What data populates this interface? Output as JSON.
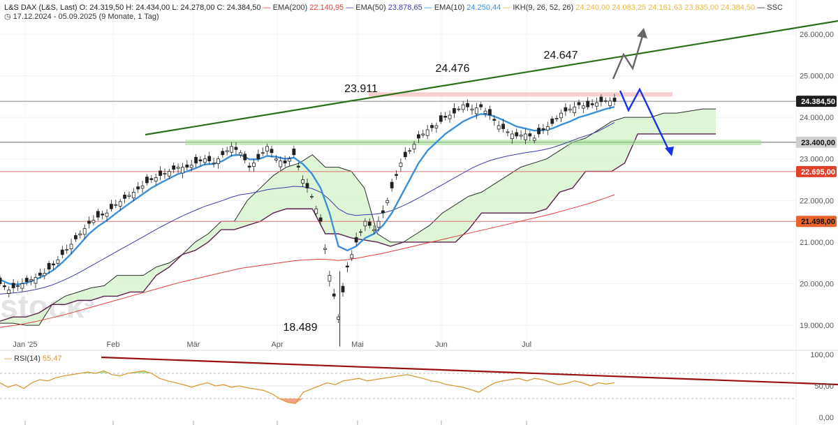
{
  "header": {
    "symbol": "L&S DAX (L&S, Last)",
    "ohlc": "O: 24.319,50   H: 24.434,00   L: 24.278,00   C: 24.384,50",
    "range": "17.12.2024 - 05.09.2025   (9 Monate, 1 Tag)",
    "indicators": [
      {
        "label": "EMA(200)",
        "value": "22.140,95",
        "color": "#e03c3c"
      },
      {
        "label": "EMA(50)",
        "value": "23.878,65",
        "color": "#3c3ca8"
      },
      {
        "label": "EMA(10)",
        "value": "24.250,44",
        "color": "#3a8fd8"
      },
      {
        "label": "IKH(9, 26, 52, 26)",
        "value": "24.240,00   24.083,25   24.161,63   23.835,00   24.384,50",
        "color": "#e6b84a"
      },
      {
        "label": "SSC",
        "value": "",
        "color": "#222222"
      }
    ]
  },
  "watermark": "stock³",
  "colors": {
    "price_up": "#222222",
    "ema10": "#3a8fd8",
    "ema50": "#3c3ca8",
    "ema200": "#e03c3c",
    "cloud_fill": "#d8f5d0",
    "cloud_fill_bear": "#f7d6d6",
    "cloud_line": "#5a1e4e",
    "trend_green": "#2a6e1a",
    "rsi_line": "#d89a3a",
    "rsi_trend": "#9a1010",
    "label_red": "#e0402a",
    "label_orange": "#e8622c",
    "label_black": "#1e1e1e"
  },
  "chart_data": {
    "type": "candlestick",
    "x_ticks": [
      "Jan '25",
      "Feb",
      "Mär",
      "Apr",
      "Mai",
      "Jun",
      "Jul"
    ],
    "y_ticks": [
      "26.000,00",
      "25.000,00",
      "24.000,00",
      "23.000,00",
      "22.000,00",
      "21.000,00",
      "20.000,00",
      "19.000,00"
    ],
    "ylim": [
      18600,
      26350
    ],
    "annotations": [
      {
        "text": "24.647",
        "date": "2025-07-10",
        "value": 24647
      },
      {
        "text": "24.476",
        "date": "2025-05-28",
        "value": 24476
      },
      {
        "text": "23.911",
        "date": "2025-05-02",
        "value": 23911
      },
      {
        "text": "18.489",
        "date": "2025-04-07",
        "value": 18489
      }
    ],
    "price_labels": [
      {
        "text": "24.384,50",
        "value": 24384.5,
        "style": "black"
      },
      {
        "text": "23.400,00",
        "value": 23400,
        "style": "gray"
      },
      {
        "text": "22.695,00",
        "value": 22695,
        "style": "red"
      },
      {
        "text": "21.498,00",
        "value": 21498,
        "style": "orange"
      }
    ],
    "horizontal_lines": [
      24384.5,
      23400,
      22695,
      21498
    ],
    "close_series": [
      20000,
      19850,
      19950,
      20050,
      20150,
      20250,
      20450,
      20700,
      20950,
      21200,
      21450,
      21600,
      21700,
      21900,
      22050,
      22200,
      22350,
      22500,
      22600,
      22700,
      22800,
      22800,
      22900,
      23000,
      22900,
      23100,
      23300,
      23150,
      22800,
      23000,
      23300,
      23000,
      22900,
      23100,
      22500,
      22100,
      21500,
      20200,
      19200,
      20400,
      21000,
      21500,
      21300,
      21700,
      22300,
      22900,
      23200,
      23500,
      23700,
      23800,
      24000,
      24100,
      24300,
      24200,
      24250,
      24050,
      23800,
      23650,
      23550,
      23600,
      23500,
      23700,
      23850,
      24100,
      24200,
      24300,
      24250,
      24350,
      24400,
      24380
    ],
    "ema10_series": [
      20100,
      20000,
      19980,
      20020,
      20100,
      20200,
      20330,
      20510,
      20720,
      20960,
      21200,
      21380,
      21520,
      21690,
      21850,
      22000,
      22150,
      22300,
      22420,
      22530,
      22640,
      22700,
      22780,
      22870,
      22880,
      22950,
      23080,
      23100,
      22990,
      22990,
      23070,
      23050,
      23000,
      23030,
      22880,
      22650,
      22300,
      21700,
      20900,
      20800,
      20900,
      21100,
      21200,
      21400,
      21700,
      22100,
      22500,
      22900,
      23200,
      23400,
      23600,
      23750,
      23900,
      24000,
      24080,
      24060,
      23980,
      23880,
      23780,
      23730,
      23680,
      23690,
      23730,
      23820,
      23900,
      24000,
      24060,
      24130,
      24200,
      24250
    ],
    "ema50_series": [
      19750,
      19770,
      19790,
      19820,
      19860,
      19910,
      19980,
      20070,
      20170,
      20280,
      20400,
      20520,
      20640,
      20760,
      20880,
      21000,
      21120,
      21240,
      21360,
      21470,
      21580,
      21680,
      21770,
      21860,
      21930,
      22000,
      22080,
      22140,
      22170,
      22210,
      22260,
      22290,
      22310,
      22340,
      22330,
      22290,
      22200,
      22020,
      21800,
      21680,
      21640,
      21660,
      21670,
      21700,
      21760,
      21850,
      21950,
      22060,
      22180,
      22300,
      22420,
      22540,
      22660,
      22780,
      22880,
      22960,
      23020,
      23070,
      23110,
      23150,
      23180,
      23220,
      23270,
      23340,
      23420,
      23500,
      23570,
      23650,
      23760,
      23878
    ],
    "ema200_series": [
      18950,
      18980,
      19010,
      19050,
      19090,
      19140,
      19190,
      19240,
      19300,
      19360,
      19420,
      19480,
      19540,
      19600,
      19660,
      19720,
      19780,
      19840,
      19900,
      19960,
      20020,
      20070,
      20120,
      20170,
      20220,
      20270,
      20320,
      20370,
      20400,
      20430,
      20460,
      20490,
      20520,
      20550,
      20570,
      20580,
      20590,
      20580,
      20560,
      20580,
      20610,
      20650,
      20690,
      20730,
      20780,
      20830,
      20880,
      20930,
      20980,
      21030,
      21080,
      21130,
      21180,
      21230,
      21280,
      21330,
      21380,
      21430,
      21480,
      21530,
      21580,
      21630,
      21680,
      21740,
      21800,
      21860,
      21920,
      21990,
      22060,
      22140
    ],
    "cloud_series": {
      "span_a": [
        19050,
        19050,
        19000,
        19000,
        19500,
        19700,
        19800,
        19900,
        19950,
        20200,
        20200,
        20200,
        20400,
        20500,
        20700,
        21000,
        21200,
        21500,
        21500,
        22000,
        22300,
        22600,
        22800,
        22900,
        23100,
        22800,
        22800,
        22700,
        22300,
        21200,
        21000,
        21000,
        21200,
        21400,
        21700,
        21900,
        22100,
        22200,
        22400,
        22600,
        22800,
        22900,
        23000,
        23200,
        23400,
        23500,
        23700,
        23900,
        24000,
        24000,
        24000,
        24100,
        24100,
        24150,
        24200,
        24200
      ],
      "span_b": [
        19100,
        19200,
        19200,
        19300,
        19500,
        19500,
        19600,
        19600,
        19700,
        19700,
        19800,
        19800,
        20200,
        20400,
        20700,
        20800,
        21000,
        21300,
        21300,
        21400,
        21500,
        21700,
        21800,
        21800,
        21800,
        21200,
        21200,
        21100,
        21050,
        21000,
        20900,
        21000,
        21000,
        21000,
        21000,
        21000,
        21300,
        21700,
        21700,
        21700,
        21700,
        21700,
        21800,
        22200,
        22300,
        22700,
        22700,
        22700,
        22900,
        23600,
        23600,
        23600,
        23600,
        23600,
        23600,
        23600
      ]
    },
    "scenario_paths": {
      "bull": [
        [
          24200,
          0
        ],
        [
          24700,
          1
        ],
        [
          24600,
          2
        ],
        [
          25750,
          3
        ]
      ],
      "bear": [
        [
          24400,
          0
        ],
        [
          23900,
          1
        ],
        [
          24400,
          2
        ],
        [
          22700,
          3
        ]
      ]
    }
  },
  "rsi": {
    "label": "RSI(14)",
    "value": "55,47",
    "y_ticks": [
      "100,00",
      "50,00",
      "0,00"
    ],
    "levels": [
      70,
      30
    ],
    "series": [
      55,
      48,
      52,
      46,
      55,
      60,
      58,
      63,
      66,
      68,
      70,
      72,
      70,
      74,
      68,
      66,
      70,
      72,
      74,
      70,
      62,
      58,
      55,
      52,
      48,
      52,
      55,
      50,
      52,
      48,
      50,
      47,
      45,
      43,
      38,
      30,
      24,
      22,
      40,
      45,
      50,
      55,
      52,
      58,
      60,
      62,
      58,
      60,
      62,
      64,
      66,
      68,
      65,
      62,
      58,
      56,
      52,
      50,
      48,
      44,
      40,
      48,
      55,
      58,
      60,
      62,
      58,
      62,
      60,
      56,
      52,
      54,
      58,
      55,
      50,
      55,
      53,
      55
    ]
  }
}
